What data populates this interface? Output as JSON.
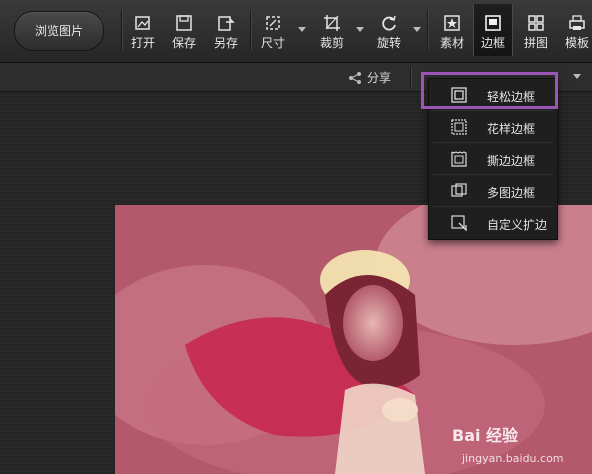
{
  "toolbar": {
    "browse_label": "浏览图片",
    "tools": [
      {
        "id": "open",
        "label": "打开",
        "icon": "open-image-icon"
      },
      {
        "id": "save",
        "label": "保存",
        "icon": "save-icon"
      },
      {
        "id": "saveas",
        "label": "另存",
        "icon": "save-as-icon"
      },
      {
        "id": "size",
        "label": "尺寸",
        "icon": "resize-icon"
      },
      {
        "id": "crop",
        "label": "裁剪",
        "icon": "crop-icon"
      },
      {
        "id": "rotate",
        "label": "旋转",
        "icon": "rotate-icon"
      },
      {
        "id": "material",
        "label": "素材",
        "icon": "star-frame-icon"
      },
      {
        "id": "frame",
        "label": "边框",
        "icon": "frame-icon"
      },
      {
        "id": "collage",
        "label": "拼图",
        "icon": "grid-icon"
      },
      {
        "id": "template",
        "label": "模板",
        "icon": "printer-icon"
      }
    ]
  },
  "subbar": {
    "share_label": "分享"
  },
  "frame_menu": {
    "items": [
      {
        "label": "轻松边框",
        "icon": "simple-frame-icon",
        "highlighted": true
      },
      {
        "label": "花样边框",
        "icon": "pattern-frame-icon"
      },
      {
        "label": "撕边边框",
        "icon": "torn-edge-frame-icon"
      },
      {
        "label": "多图边框",
        "icon": "multi-image-frame-icon"
      },
      {
        "label": "自定义扩边",
        "icon": "custom-border-icon"
      }
    ]
  },
  "watermark": {
    "text": "Bai 经验",
    "sub": "jingyan.baidu.com"
  },
  "colors": {
    "highlight": "#9a55b6",
    "toolbar_bg": "#2a2a2a"
  }
}
